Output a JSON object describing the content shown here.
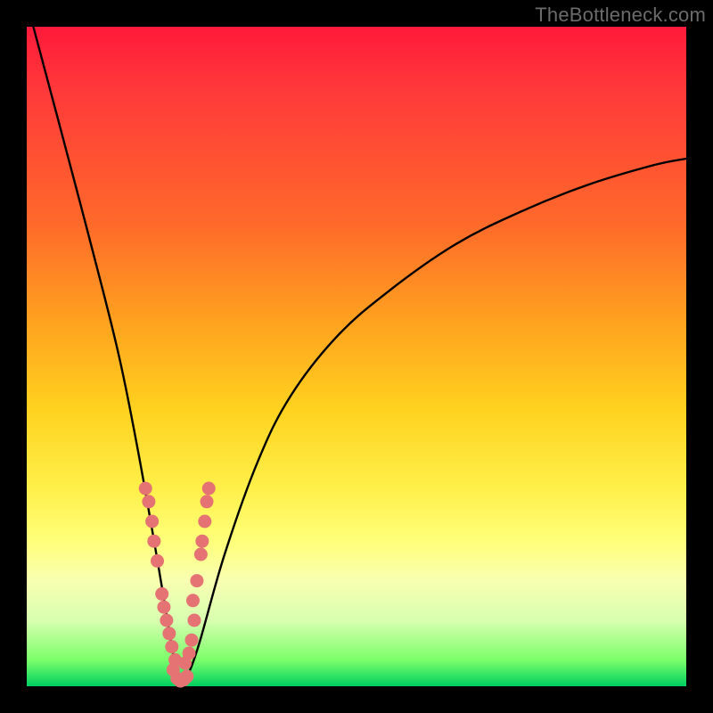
{
  "watermark": "TheBottleneck.com",
  "colors": {
    "background": "#000000",
    "curve": "#000000",
    "dot": "#e57373",
    "gradient_top": "#ff1a3a",
    "gradient_bottom": "#00d060"
  },
  "chart_data": {
    "type": "line",
    "title": "",
    "xlabel": "",
    "ylabel": "",
    "xlim": [
      0,
      100
    ],
    "ylim": [
      0,
      100
    ],
    "curve_description": "V-shaped bottleneck curve: steep drop on the left branch to ~0% near x≈23%, then damped rise on the right branch approaching ~80% at right edge.",
    "series": [
      {
        "name": "bottleneck-curve",
        "x": [
          1,
          5,
          10,
          14,
          17,
          20,
          22,
          23,
          24,
          26,
          30,
          35,
          40,
          47,
          55,
          65,
          75,
          85,
          95,
          100
        ],
        "y": [
          100,
          85,
          66,
          50,
          35,
          18,
          6,
          1,
          1,
          6,
          20,
          34,
          44,
          53,
          60,
          67,
          72,
          76,
          79,
          80
        ]
      }
    ],
    "highlight_points": {
      "name": "sample-dots-near-minimum",
      "description": "Pink sample markers clustered on both branches around the valley (~x 17–27%, y 0–30%).",
      "points": [
        {
          "x": 18.0,
          "y": 30
        },
        {
          "x": 18.5,
          "y": 28
        },
        {
          "x": 19.0,
          "y": 25
        },
        {
          "x": 19.3,
          "y": 22
        },
        {
          "x": 19.8,
          "y": 19
        },
        {
          "x": 20.5,
          "y": 14
        },
        {
          "x": 20.8,
          "y": 12
        },
        {
          "x": 21.2,
          "y": 10
        },
        {
          "x": 21.6,
          "y": 8
        },
        {
          "x": 22.0,
          "y": 6
        },
        {
          "x": 22.5,
          "y": 4
        },
        {
          "x": 22.2,
          "y": 2.5
        },
        {
          "x": 22.8,
          "y": 1.2
        },
        {
          "x": 23.3,
          "y": 0.8
        },
        {
          "x": 23.8,
          "y": 1.0
        },
        {
          "x": 24.3,
          "y": 1.5
        },
        {
          "x": 24.0,
          "y": 3.5
        },
        {
          "x": 24.6,
          "y": 5
        },
        {
          "x": 25.0,
          "y": 7
        },
        {
          "x": 25.4,
          "y": 10
        },
        {
          "x": 25.2,
          "y": 13
        },
        {
          "x": 25.8,
          "y": 16
        },
        {
          "x": 26.4,
          "y": 20
        },
        {
          "x": 26.6,
          "y": 22
        },
        {
          "x": 27.0,
          "y": 25
        },
        {
          "x": 27.3,
          "y": 28
        },
        {
          "x": 27.6,
          "y": 30
        }
      ]
    }
  }
}
